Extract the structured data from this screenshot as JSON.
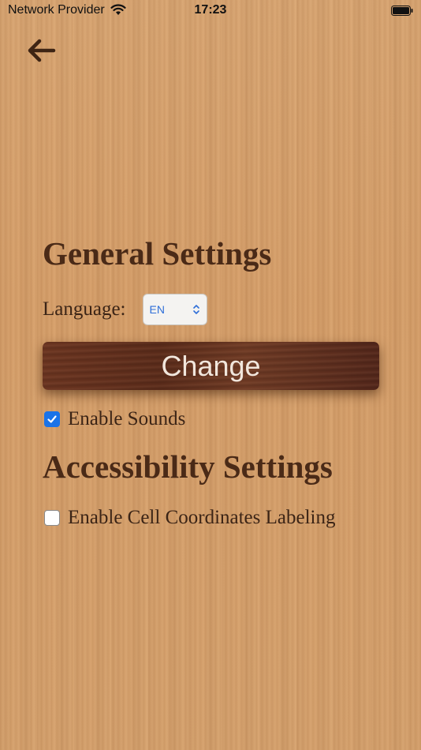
{
  "status_bar": {
    "carrier": "Network Provider",
    "time": "17:23",
    "icons": [
      "wifi-icon",
      "battery-icon"
    ]
  },
  "nav": {
    "back_icon": "arrow-left-icon"
  },
  "general": {
    "title": "General Settings",
    "language_label": "Language:",
    "language_value": "EN",
    "change_label": "Change",
    "sounds_label": "Enable Sounds",
    "sounds_checked": true
  },
  "accessibility": {
    "title": "Accessibility Settings",
    "coords_label": "Enable Cell Coordinates Labeling",
    "coords_checked": false
  },
  "colors": {
    "heading": "#4a2a17",
    "checkbox_accent": "#1a73e8",
    "select_text": "#2f6fd8",
    "button_text": "#f1e6dc"
  }
}
